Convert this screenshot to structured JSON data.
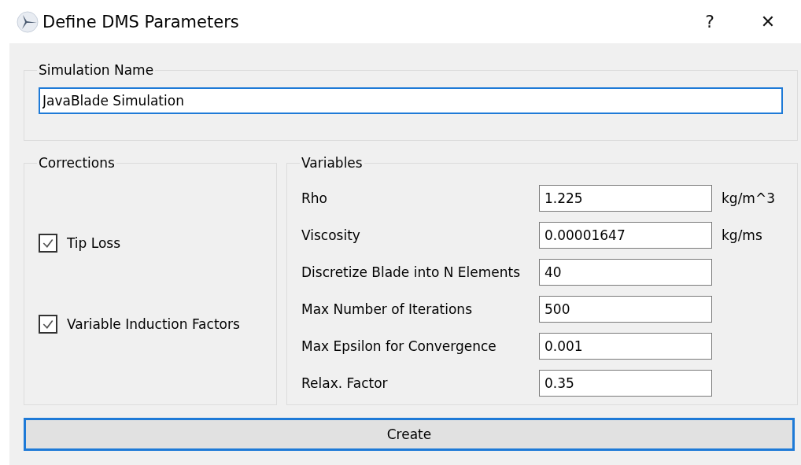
{
  "window": {
    "title": "Define DMS Parameters",
    "help": "?",
    "close": "✕"
  },
  "simulation_name": {
    "legend": "Simulation Name",
    "value": "JavaBlade Simulation"
  },
  "corrections": {
    "legend": "Corrections",
    "items": [
      {
        "label": "Tip Loss",
        "checked": true
      },
      {
        "label": "Variable Induction Factors",
        "checked": true
      }
    ]
  },
  "variables": {
    "legend": "Variables",
    "rows": [
      {
        "label": "Rho",
        "value": "1.225",
        "unit": "kg/m^3"
      },
      {
        "label": "Viscosity",
        "value": "0.00001647",
        "unit": "kg/ms"
      },
      {
        "label": "Discretize Blade into N Elements",
        "value": "40"
      },
      {
        "label": "Max Number of Iterations",
        "value": "500"
      },
      {
        "label": "Max Epsilon for Convergence",
        "value": "0.001"
      },
      {
        "label": "Relax. Factor",
        "value": "0.35"
      }
    ]
  },
  "create_button": "Create"
}
